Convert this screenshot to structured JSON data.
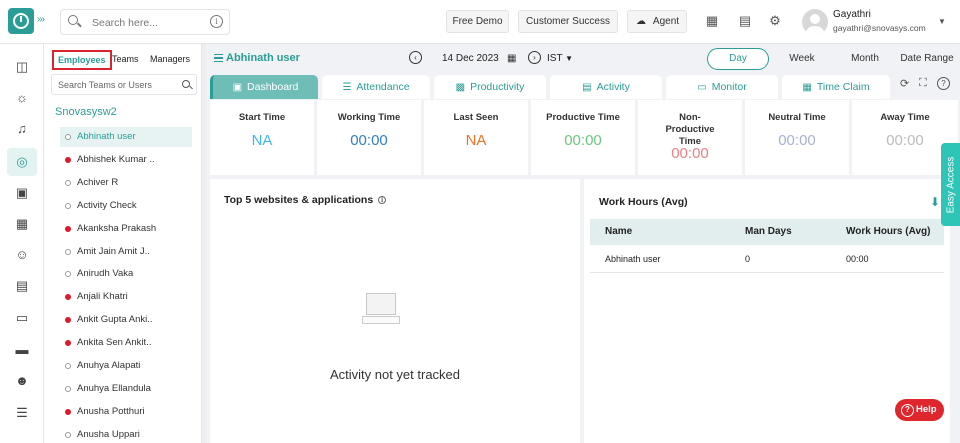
{
  "header": {
    "search_placeholder": "Search here...",
    "buttons": {
      "free_demo": "Free Demo",
      "customer_success": "Customer Success",
      "agent": "Agent"
    },
    "user": {
      "name": "Gayathri",
      "email": "gayathri@snovasys.com"
    }
  },
  "panel": {
    "tabs": {
      "employees": "Employees",
      "teams": "Teams",
      "managers": "Managers"
    },
    "search_placeholder": "Search Teams or Users",
    "org_name": "Snovasysw2",
    "employees": [
      {
        "name": "Abhinath user",
        "status": "offline",
        "selected": true
      },
      {
        "name": "Abhishek Kumar ..",
        "status": "red"
      },
      {
        "name": "Achiver R",
        "status": "offline"
      },
      {
        "name": "Activity Check",
        "status": "offline"
      },
      {
        "name": "Akanksha Prakash",
        "status": "red"
      },
      {
        "name": "Amit Jain Amit J..",
        "status": "offline"
      },
      {
        "name": "Anirudh Vaka",
        "status": "offline"
      },
      {
        "name": "Anjali Khatri",
        "status": "red"
      },
      {
        "name": "Ankit Gupta Anki..",
        "status": "red"
      },
      {
        "name": "Ankita Sen Ankit..",
        "status": "red"
      },
      {
        "name": "Anuhya Alapati",
        "status": "offline"
      },
      {
        "name": "Anuhya Ellandula",
        "status": "offline"
      },
      {
        "name": "Anusha Potthuri",
        "status": "red"
      },
      {
        "name": "Anusha Uppari",
        "status": "offline"
      }
    ]
  },
  "main": {
    "user_title": "Abhinath user",
    "date": "14 Dec 2023",
    "timezone": "IST",
    "periods": {
      "day": "Day",
      "week": "Week",
      "month": "Month",
      "date_range": "Date Range"
    },
    "tabs": {
      "dashboard": "Dashboard",
      "attendance": "Attendance",
      "productivity": "Productivity",
      "activity": "Activity",
      "monitor": "Monitor",
      "time_claim": "Time Claim"
    },
    "stats": {
      "start_time": {
        "label": "Start Time",
        "value": "NA",
        "color": "#3fb6e8"
      },
      "working_time": {
        "label": "Working Time",
        "value": "00:00",
        "color": "#2f7fc9"
      },
      "last_seen": {
        "label": "Last Seen",
        "value": "NA",
        "color": "#e8742a"
      },
      "productive_time": {
        "label": "Productive Time",
        "value": "00:00",
        "color": "#6cc77d"
      },
      "non_productive_time": {
        "label": "Non-Productive Time",
        "value": "00:00",
        "color": "#ef7d87"
      },
      "neutral_time": {
        "label": "Neutral Time",
        "value": "00:00",
        "color": "#a7b1d6"
      },
      "away_time": {
        "label": "Away Time",
        "value": "00:00",
        "color": "#bcbcbc"
      }
    },
    "websites": {
      "title": "Top 5 websites & applications",
      "empty_message": "Activity not yet tracked"
    },
    "work_hours": {
      "title": "Work Hours (Avg)",
      "columns": {
        "name": "Name",
        "man_days": "Man Days",
        "work_hours": "Work Hours (Avg)"
      },
      "row": {
        "name": "Abhinath user",
        "man_days": "0",
        "work_hours": "00:00"
      }
    }
  },
  "easy_access": "Easy Access",
  "help": "Help",
  "colors": {
    "accent": "#2a9d96",
    "danger": "#e0262d"
  }
}
